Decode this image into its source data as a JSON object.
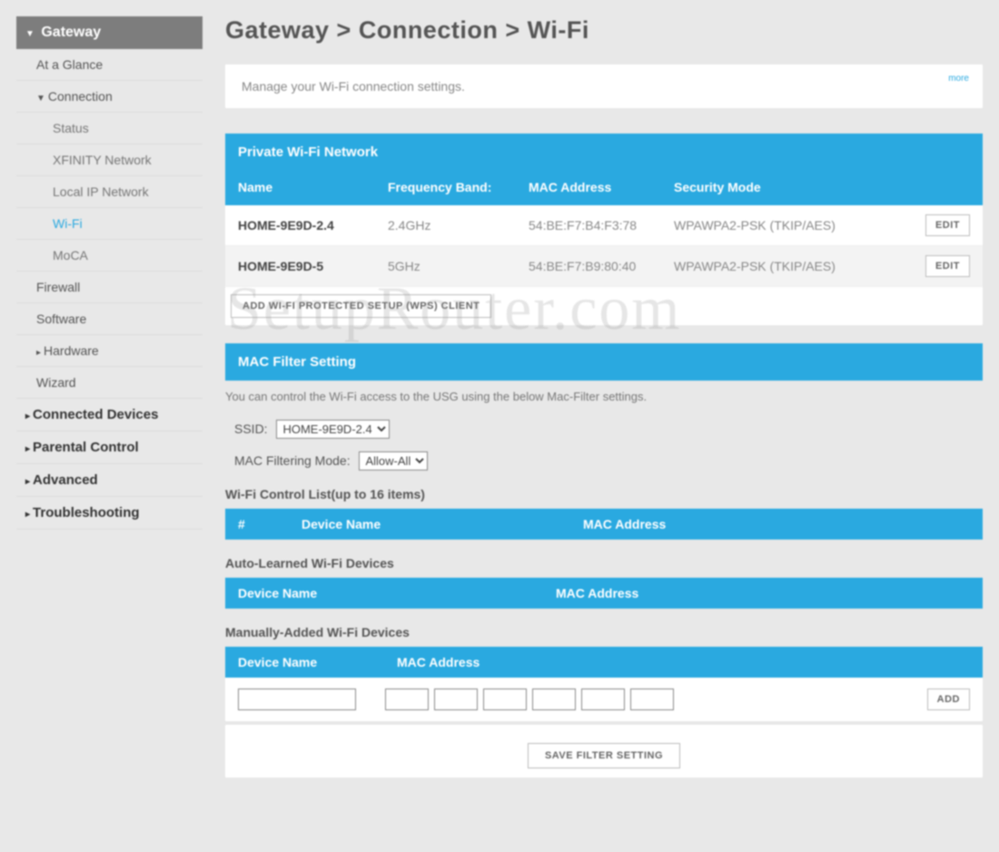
{
  "sidebar": {
    "header": "Gateway",
    "items": [
      {
        "label": "At a Glance",
        "level": "sub1"
      },
      {
        "label": "Connection",
        "level": "sub1",
        "caret": true
      },
      {
        "label": "Status",
        "level": "sub2"
      },
      {
        "label": "XFINITY Network",
        "level": "sub2"
      },
      {
        "label": "Local IP Network",
        "level": "sub2"
      },
      {
        "label": "Wi-Fi",
        "level": "sub2",
        "active": true
      },
      {
        "label": "MoCA",
        "level": "sub2"
      },
      {
        "label": "Firewall",
        "level": "sub1"
      },
      {
        "label": "Software",
        "level": "sub1"
      },
      {
        "label": "Hardware",
        "level": "sub1",
        "caret_right": true
      },
      {
        "label": "Wizard",
        "level": "sub1"
      },
      {
        "label": "Connected Devices",
        "level": "top-level",
        "caret_right": true
      },
      {
        "label": "Parental Control",
        "level": "top-level",
        "caret_right": true
      },
      {
        "label": "Advanced",
        "level": "top-level",
        "caret_right": true
      },
      {
        "label": "Troubleshooting",
        "level": "top-level",
        "caret_right": true
      }
    ]
  },
  "breadcrumb": "Gateway > Connection > Wi-Fi",
  "info_text": "Manage your Wi-Fi connection settings.",
  "info_link": "more",
  "private_wifi": {
    "title": "Private Wi-Fi Network",
    "cols": {
      "name": "Name",
      "band": "Frequency Band:",
      "mac": "MAC Address",
      "sec": "Security Mode"
    },
    "rows": [
      {
        "name": "HOME-9E9D-2.4",
        "band": "2.4GHz",
        "mac": "54:BE:F7:B4:F3:78",
        "sec": "WPAWPA2-PSK (TKIP/AES)",
        "edit": "EDIT"
      },
      {
        "name": "HOME-9E9D-5",
        "band": "5GHz",
        "mac": "54:BE:F7:B9:80:40",
        "sec": "WPAWPA2-PSK (TKIP/AES)",
        "edit": "EDIT"
      }
    ],
    "wps_button": "ADD WI-FI PROTECTED SETUP (WPS) CLIENT"
  },
  "mac_filter": {
    "title": "MAC Filter Setting",
    "desc": "You can control the Wi-Fi access to the USG using the below Mac-Filter settings.",
    "ssid_label": "SSID:",
    "ssid_options": [
      "HOME-9E9D-2.4"
    ],
    "mode_label": "MAC Filtering Mode:",
    "mode_options": [
      "Allow-All"
    ],
    "control_list_title": "Wi-Fi Control List(up to 16 items)",
    "control_cols": {
      "idx": "#",
      "dev": "Device Name",
      "mac": "MAC Address"
    },
    "auto_title": "Auto-Learned Wi-Fi Devices",
    "auto_cols": {
      "dev": "Device Name",
      "mac": "MAC Address"
    },
    "manual_title": "Manually-Added Wi-Fi Devices",
    "manual_cols": {
      "dev": "Device Name",
      "mac": "MAC Address"
    },
    "add_button": "ADD",
    "save_button": "SAVE FILTER SETTING"
  },
  "watermark": "SetupRouter.com"
}
